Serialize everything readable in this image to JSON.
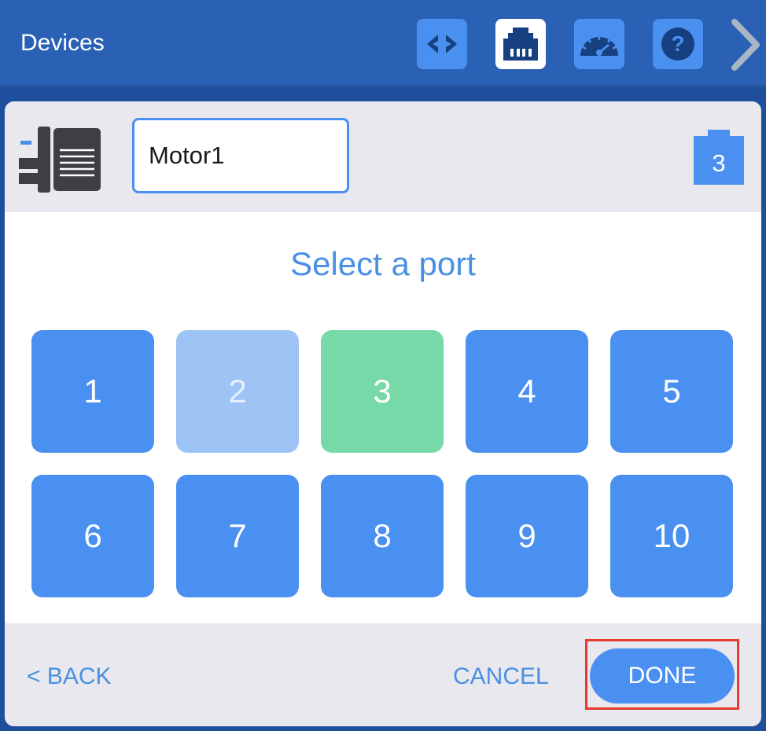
{
  "header": {
    "title": "Devices",
    "tools": [
      {
        "icon": "code-brackets-icon",
        "active": false
      },
      {
        "icon": "ethernet-port-icon",
        "active": true
      },
      {
        "icon": "speedometer-icon",
        "active": false
      },
      {
        "icon": "help-icon",
        "active": false
      }
    ],
    "next_icon": "chevron-right-icon"
  },
  "device": {
    "icon": "motor-icon",
    "name_value": "Motor1",
    "port_badge": "3"
  },
  "port_picker": {
    "title": "Select a port",
    "ports": [
      {
        "label": "1",
        "state": "available"
      },
      {
        "label": "2",
        "state": "unavailable"
      },
      {
        "label": "3",
        "state": "selected"
      },
      {
        "label": "4",
        "state": "available"
      },
      {
        "label": "5",
        "state": "available"
      },
      {
        "label": "6",
        "state": "available"
      },
      {
        "label": "7",
        "state": "available"
      },
      {
        "label": "8",
        "state": "available"
      },
      {
        "label": "9",
        "state": "available"
      },
      {
        "label": "10",
        "state": "available"
      }
    ]
  },
  "footer": {
    "back_label": "< BACK",
    "cancel_label": "CANCEL",
    "done_label": "DONE"
  },
  "colors": {
    "accent": "#4a90f0",
    "selected": "#78d9a8",
    "unavailable": "#9ec3f5",
    "header": "#2a61b5",
    "highlight": "#e53a2c"
  }
}
